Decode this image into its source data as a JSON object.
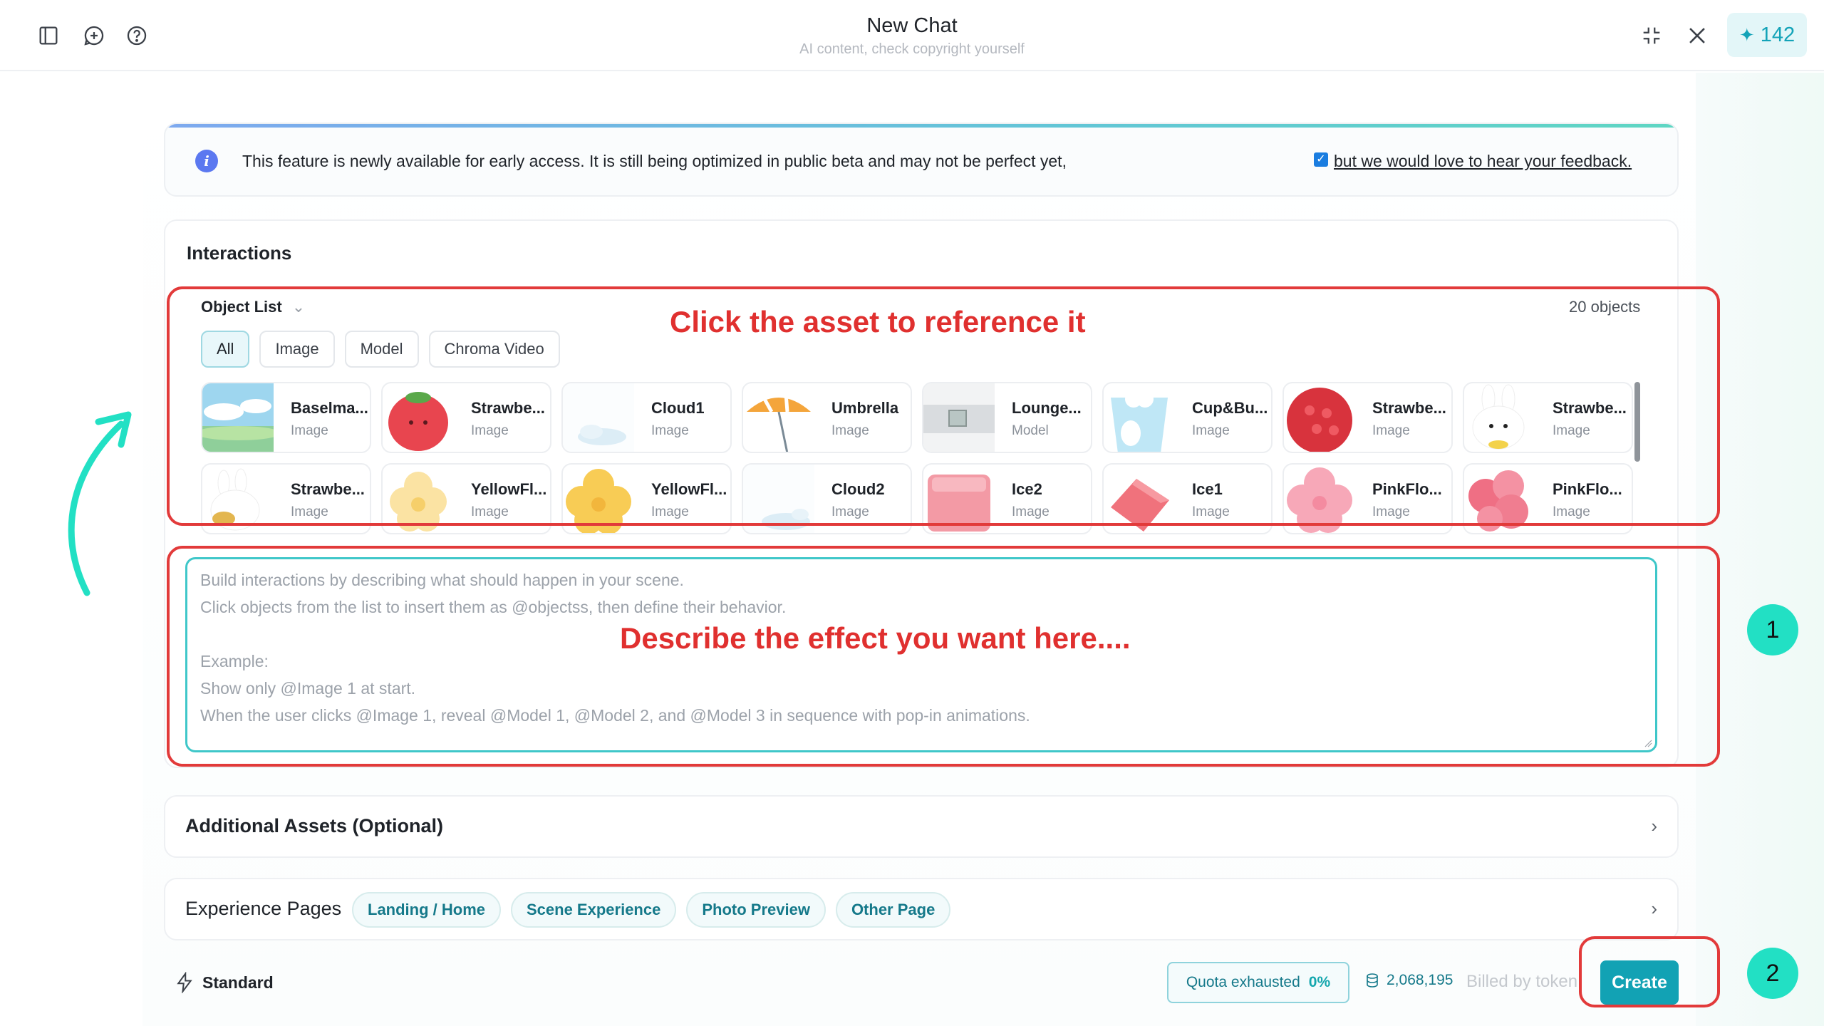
{
  "header": {
    "title": "New Chat",
    "subtitle": "AI content, check copyright yourself",
    "credits": "142"
  },
  "notice": {
    "message": "This feature is newly available for early access. It is still being optimized in public beta and may not be perfect yet,",
    "link": "but we would love to hear your feedback."
  },
  "interactions": {
    "title": "Interactions",
    "object_list_label": "Object List",
    "count": "20 objects",
    "filters": [
      "All",
      "Image",
      "Model",
      "Chroma Video"
    ],
    "objects": [
      {
        "name": "Baselma...",
        "type": "Image"
      },
      {
        "name": "Strawbe...",
        "type": "Image"
      },
      {
        "name": "Cloud1",
        "type": "Image"
      },
      {
        "name": "Umbrella",
        "type": "Image"
      },
      {
        "name": "Lounge...",
        "type": "Model"
      },
      {
        "name": "Cup&Bu...",
        "type": "Image"
      },
      {
        "name": "Strawbe...",
        "type": "Image"
      },
      {
        "name": "Strawbe...",
        "type": "Image"
      },
      {
        "name": "Strawbe...",
        "type": "Image"
      },
      {
        "name": "YellowFl...",
        "type": "Image"
      },
      {
        "name": "YellowFl...",
        "type": "Image"
      },
      {
        "name": "Cloud2",
        "type": "Image"
      },
      {
        "name": "Ice2",
        "type": "Image"
      },
      {
        "name": "Ice1",
        "type": "Image"
      },
      {
        "name": "PinkFlo...",
        "type": "Image"
      },
      {
        "name": "PinkFlo...",
        "type": "Image"
      }
    ],
    "placeholder_lines": [
      "Build interactions by describing what should happen in your scene.",
      "Click objects from the list to insert them as @objectss, then define their behavior.",
      "Example:",
      "Show only @Image 1 at start.",
      "When the user clicks @Image 1, reveal @Model 1, @Model 2, and @Model 3 in sequence with pop-in animations."
    ]
  },
  "additional_assets": {
    "label": "Additional Assets (Optional)"
  },
  "experience_pages": {
    "label": "Experience Pages",
    "pages": [
      "Landing / Home",
      "Scene Experience",
      "Photo Preview",
      "Other Page"
    ]
  },
  "footer": {
    "mode": "Standard",
    "quota_label": "Quota exhausted",
    "quota_value": "0%",
    "tokens": "2,068,195",
    "billed": "Billed by token",
    "create": "Create"
  },
  "annotations": {
    "asset_hint": "Click the asset to reference it",
    "describe_hint": "Describe the effect you want here....",
    "step1": "1",
    "step2": "2",
    "accent_color": "#e23a3a",
    "arrow_color": "#22e0c4"
  }
}
